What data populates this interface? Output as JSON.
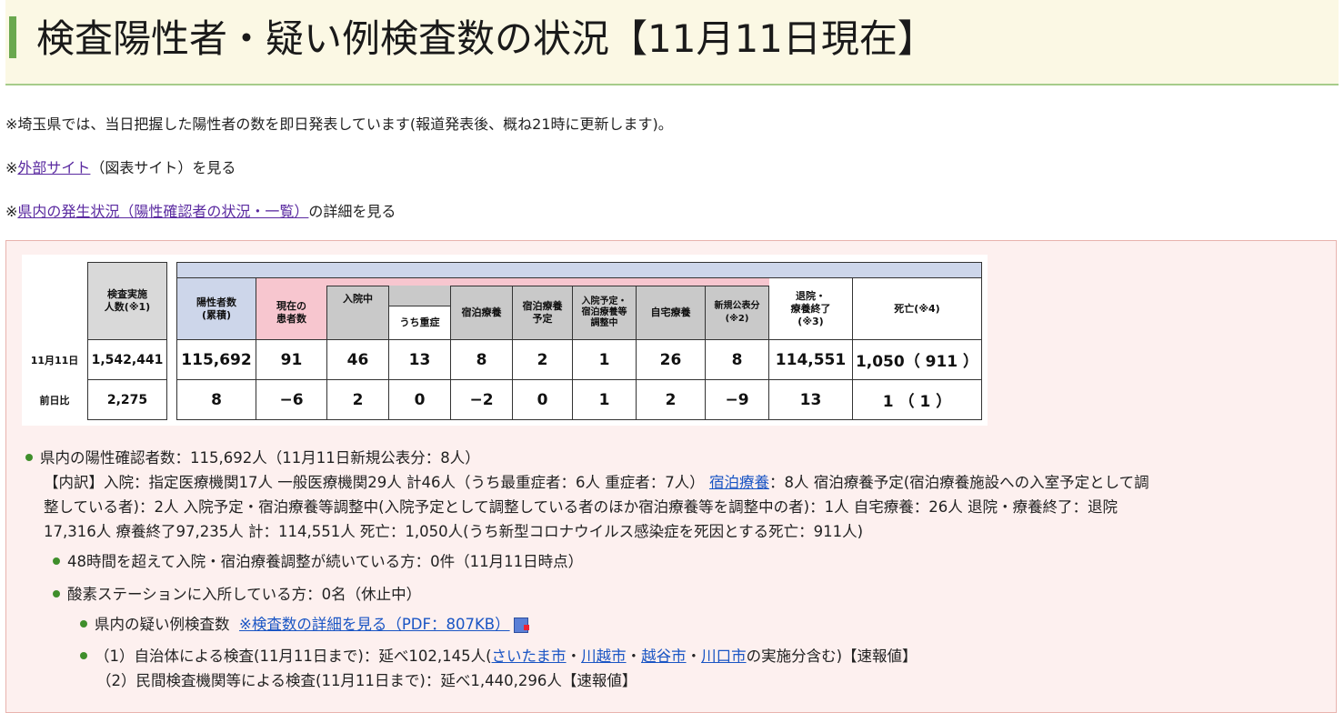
{
  "title": "検査陽性者・疑い例検査数の状況【11月11日現在】",
  "notes": {
    "n1": "※埼玉県では、当日把握した陽性者の数を即日発表しています(報道発表後、概ね21時に更新します)。",
    "n2_prefix": "※",
    "n2_link": "外部サイト",
    "n2_suffix": "（図表サイト）を見る",
    "n3_prefix": "※",
    "n3_link": "県内の発生状況（陽性確認者の状況・一覧）",
    "n3_suffix": "の詳細を見る"
  },
  "table": {
    "headers": {
      "tests": "検査実施\n人数(※1)",
      "positives": "陽性者数\n(累積)",
      "current": "現在の\n患者数",
      "hospital": "入院中",
      "severe": "うち重症",
      "hotel": "宿泊療養",
      "hotel_plan": "宿泊療養\n予定",
      "adjusting": "入院予定・\n宿泊療養等\n調整中",
      "home": "自宅療養",
      "new": "新規公表分\n(※2)",
      "recovered": "退院・\n療養終了\n(※3)",
      "deaths": "死亡(※4)"
    },
    "row1": {
      "label": "11月11日",
      "tests": "1,542,441",
      "positives": "115,692",
      "current": "91",
      "hospital": "46",
      "severe": "13",
      "hotel": "8",
      "hotel_plan": "2",
      "adjusting": "1",
      "home": "26",
      "new": "8",
      "recovered": "114,551",
      "deaths": "1,050（ 911 ）"
    },
    "row2": {
      "label": "前日比",
      "tests": "2,275",
      "positives": "8",
      "current": "−6",
      "hospital": "2",
      "severe": "0",
      "hotel": "−2",
      "hotel_plan": "0",
      "adjusting": "1",
      "home": "2",
      "new": "−9",
      "recovered": "13",
      "deaths": "1 （ 1 ）"
    }
  },
  "summary": {
    "line1": "県内の陽性確認者数：115,692人（11月11日新規公表分：8人）",
    "line2a": "【内訳】入院：指定医療機関17人 一般医療機関29人 計46人（うち最重症者：6人 重症者：7人）",
    "line2_link": "宿泊療養",
    "line2b": "：8人 宿泊療養予定(宿泊療養施設への入室予定として調",
    "line3": "整している者)：2人 入院予定・宿泊療養等調整中(入院予定として調整している者のほか宿泊療養等を調整中の者)：1人 自宅療養：26人 退院・療養終了：退院",
    "line4": "17,316人 療養終了97,235人 計：114,551人 死亡：1,050人(うち新型コロナウイルス感染症を死因とする死亡：911人)"
  },
  "bullets": {
    "b1": "48時間を超えて入院・宿泊療養調整が続いている方：0件（11月11日時点）",
    "b2": "酸素ステーションに入所している方：0名（休止中）",
    "b3_prefix": "県内の疑い例検査数",
    "b3_link": "※検査数の詳細を見る（PDF：807KB）",
    "b4_a": "（1）自治体による検査(11月11日まで)：延べ102,145人(",
    "b4_link1": "さいたま市",
    "b4_sep1": "・",
    "b4_link2": "川越市",
    "b4_sep2": "・",
    "b4_link3": "越谷市",
    "b4_sep3": "・",
    "b4_link4": "川口市",
    "b4_b": "の実施分含む)【速報値】",
    "b5": "（2）民間検査機関等による検査(11月11日まで)：延べ1,440,296人【速報値】"
  },
  "colors": {
    "title_bg": "#fbf8e4",
    "title_accent": "#6aa84f",
    "panel_bg": "#fdf0ef",
    "pink_header": "#f7c6cf",
    "gray_header": "#c9c9c9",
    "blue_header": "#cdd6ea",
    "bullet": "#3f8e2b"
  }
}
